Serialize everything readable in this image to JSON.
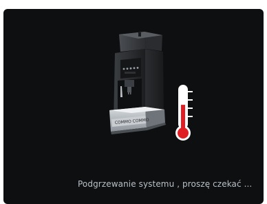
{
  "machine": {
    "icon": "coffee-machine-icon",
    "brand_label": "COMMO COMMO"
  },
  "thermometer": {
    "icon": "thermometer-icon",
    "level_fraction": 0.62,
    "mercury_color": "#e01f25"
  },
  "status": {
    "message": "Podgrzewanie systemu , proszę czekać ..."
  },
  "colors": {
    "background": "#0e0f10",
    "text": "#b9c0c7"
  }
}
